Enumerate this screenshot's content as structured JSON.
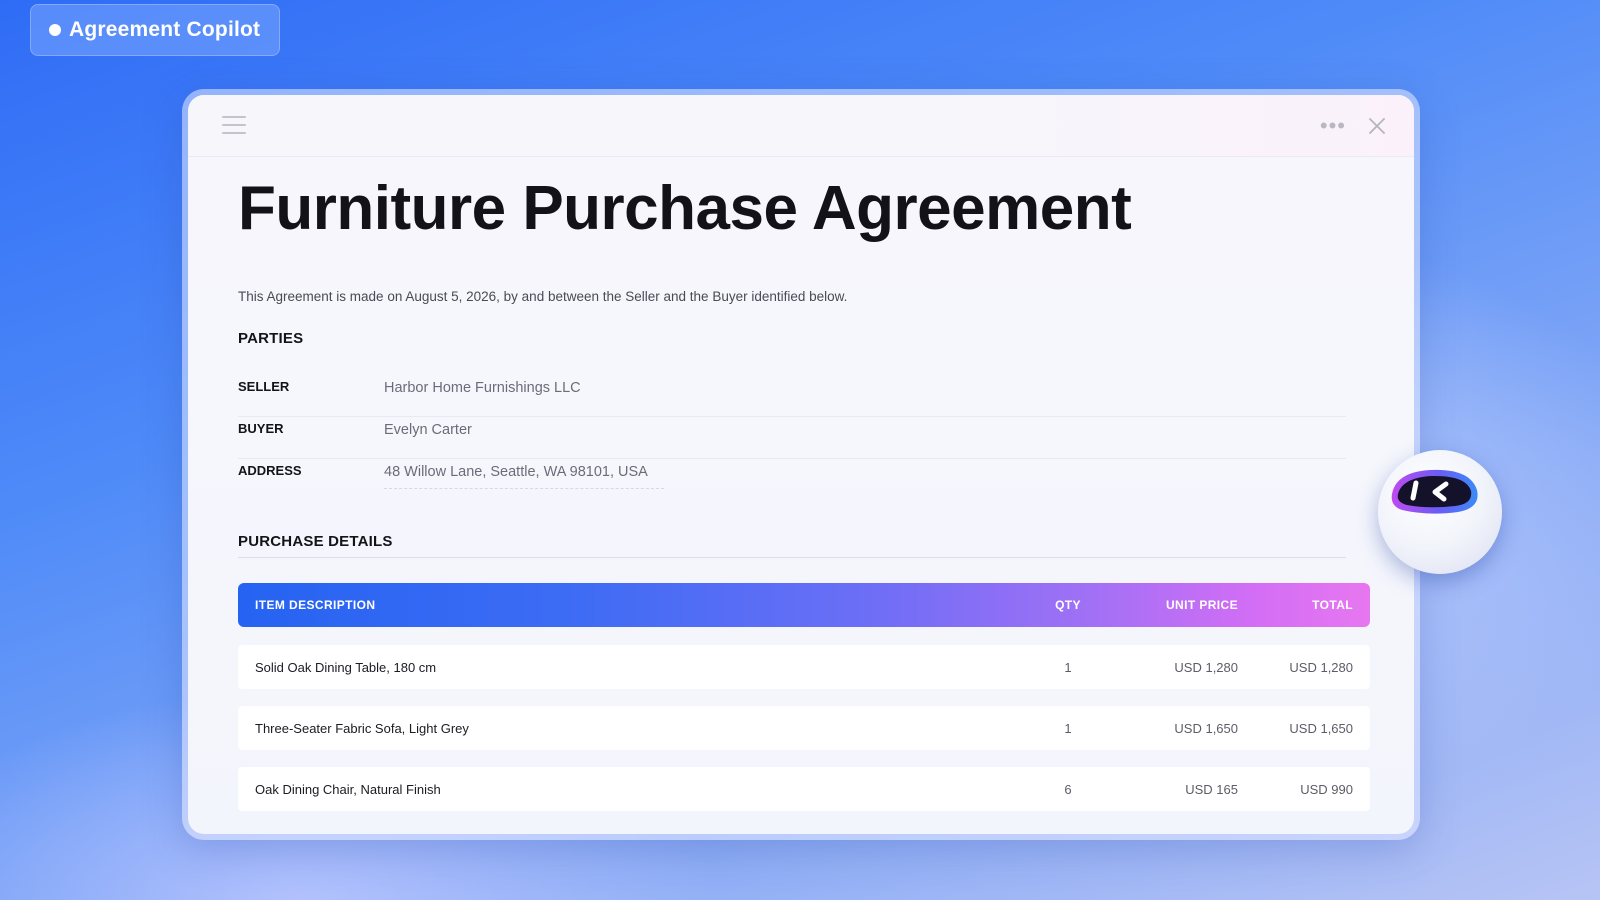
{
  "app": {
    "name": "Agreement Copilot"
  },
  "document": {
    "title": "Furniture Purchase Agreement",
    "intro": "This Agreement is made on August 5, 2026, by and between the Seller and the Buyer identified below.",
    "parties": {
      "heading": "PARTIES",
      "rows": [
        {
          "label": "SELLER",
          "value": "Harbor Home Furnishings LLC"
        },
        {
          "label": "BUYER",
          "value": "Evelyn Carter"
        },
        {
          "label": "ADDRESS",
          "value": "48 Willow Lane, Seattle, WA 98101, USA"
        }
      ]
    },
    "purchase": {
      "heading": "PURCHASE DETAILS",
      "columns": {
        "description": "ITEM DESCRIPTION",
        "qty": "QTY",
        "unit_price": "UNIT PRICE",
        "total": "TOTAL"
      },
      "items": [
        {
          "description": "Solid Oak Dining Table, 180 cm",
          "qty": "1",
          "unit_price": "USD 1,280",
          "total": "USD 1,280"
        },
        {
          "description": "Three-Seater Fabric Sofa, Light Grey",
          "qty": "1",
          "unit_price": "USD 1,650",
          "total": "USD 1,650"
        },
        {
          "description": "Oak Dining Chair, Natural Finish",
          "qty": "6",
          "unit_price": "USD 165",
          "total": "USD 990"
        }
      ]
    }
  },
  "icons": {
    "menu": "hamburger-menu-icon",
    "more": "more-options-icon",
    "close": "close-icon",
    "assistant": "robot-assistant-icon"
  },
  "colors": {
    "accent_blue": "#2563f2",
    "accent_pink": "#e777f0",
    "background": "#3a76f7"
  }
}
